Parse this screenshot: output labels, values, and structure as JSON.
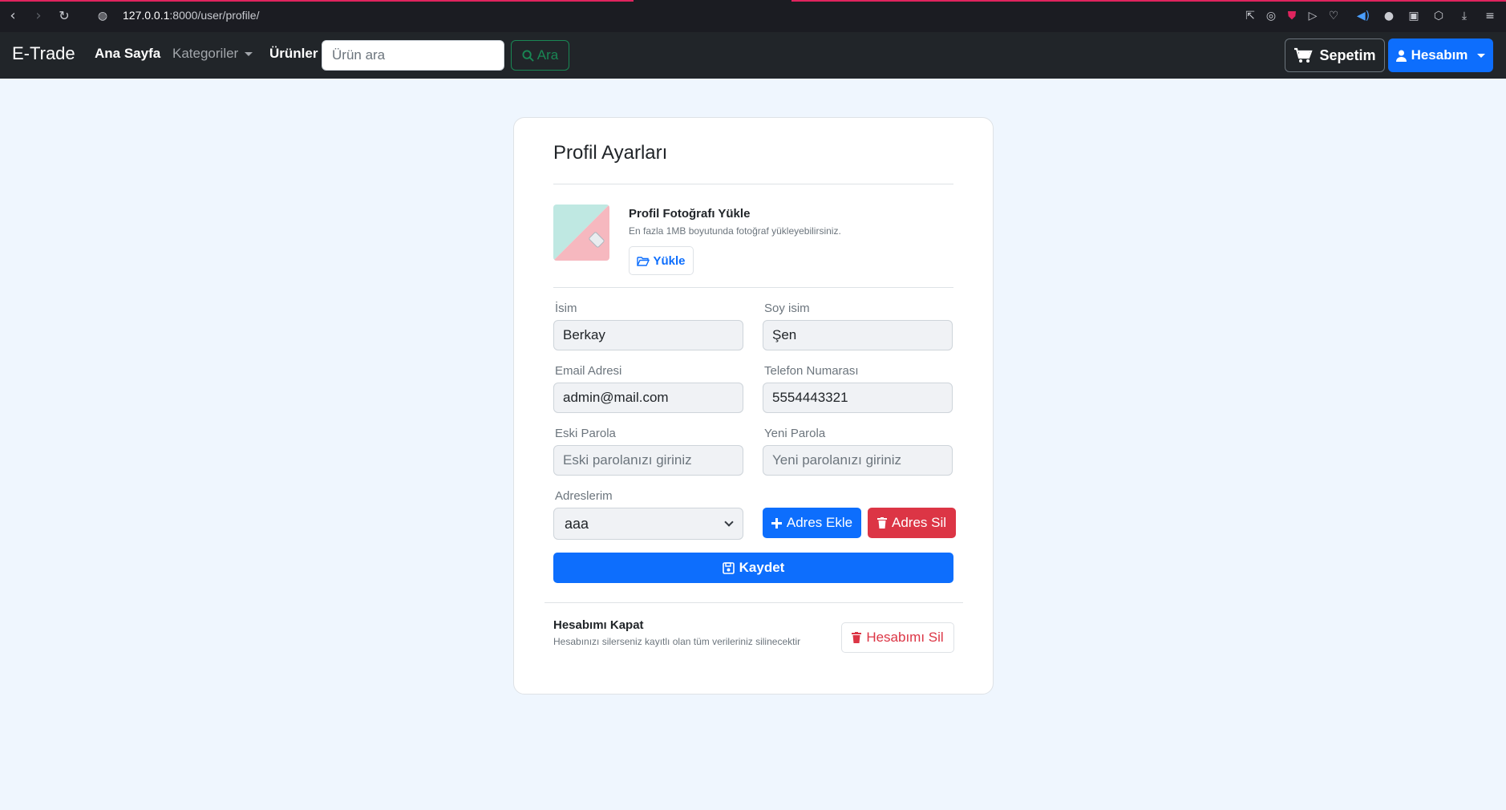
{
  "browser": {
    "url_host": "127.0.0.1",
    "url_path": ":8000/user/profile/"
  },
  "navbar": {
    "brand": "E-Trade",
    "home_label": "Ana Sayfa",
    "categories_label": "Kategoriler",
    "products_label": "Ürünler",
    "search_placeholder": "Ürün ara",
    "search_button": "Ara",
    "cart_label": "Sepetim",
    "account_label": "Hesabım"
  },
  "profile": {
    "title": "Profil Ayarları",
    "photo": {
      "title": "Profil Fotoğrafı Yükle",
      "subtitle": "En fazla 1MB boyutunda fotoğraf yükleyebilirsiniz.",
      "upload_button": "Yükle"
    },
    "fields": {
      "first_name_label": "İsim",
      "first_name_value": "Berkay",
      "last_name_label": "Soy isim",
      "last_name_value": "Şen",
      "email_label": "Email Adresi",
      "email_value": "admin@mail.com",
      "phone_label": "Telefon Numarası",
      "phone_value": "5554443321",
      "old_password_label": "Eski Parola",
      "old_password_placeholder": "Eski parolanızı giriniz",
      "new_password_label": "Yeni Parola",
      "new_password_placeholder": "Yeni parolanızı giriniz",
      "addresses_label": "Adreslerim",
      "address_selected": "aaa"
    },
    "add_address_button": "Adres Ekle",
    "delete_address_button": "Adres Sil",
    "save_button": "Kaydet",
    "close_account": {
      "title": "Hesabımı Kapat",
      "subtitle": "Hesabınızı silerseniz kayıtlı olan tüm verileriniz silinecektir",
      "button": "Hesabımı Sil"
    }
  },
  "colors": {
    "primary": "#0d6efd",
    "danger": "#dc3545",
    "success": "#198754",
    "navbar": "#212529",
    "page_bg": "#eff6fe"
  }
}
